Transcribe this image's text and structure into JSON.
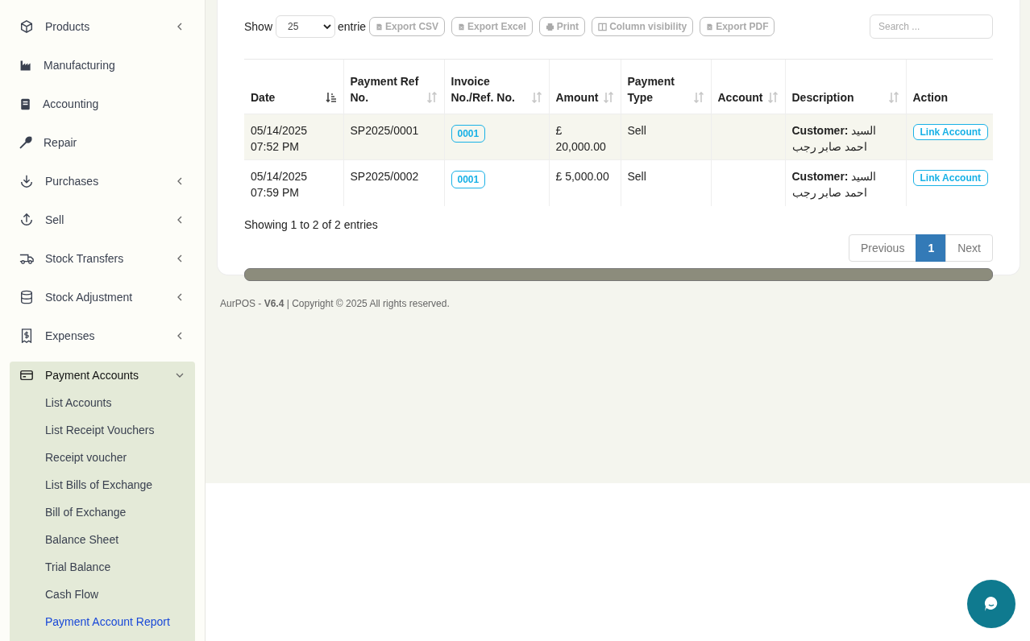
{
  "sidebar": {
    "items": [
      {
        "label": "Products",
        "expandable": true,
        "expanded": false
      },
      {
        "label": "Manufacturing",
        "expandable": false,
        "expanded": false
      },
      {
        "label": "Accounting",
        "expandable": false,
        "expanded": false
      },
      {
        "label": "Repair",
        "expandable": false,
        "expanded": false
      },
      {
        "label": "Purchases",
        "expandable": true,
        "expanded": false
      },
      {
        "label": "Sell",
        "expandable": true,
        "expanded": false
      },
      {
        "label": "Stock Transfers",
        "expandable": true,
        "expanded": false
      },
      {
        "label": "Stock Adjustment",
        "expandable": true,
        "expanded": false
      },
      {
        "label": "Expenses",
        "expandable": true,
        "expanded": false
      },
      {
        "label": "Payment Accounts",
        "expandable": true,
        "expanded": true,
        "children": [
          {
            "label": "List Accounts",
            "selected": false
          },
          {
            "label": "List Receipt Vouchers",
            "selected": false
          },
          {
            "label": "Receipt voucher",
            "selected": false
          },
          {
            "label": "List Bills of Exchange",
            "selected": false
          },
          {
            "label": "Bill of Exchange",
            "selected": false
          },
          {
            "label": "Balance Sheet",
            "selected": false
          },
          {
            "label": "Trial Balance",
            "selected": false
          },
          {
            "label": "Cash Flow",
            "selected": false
          },
          {
            "label": "Payment Account Report",
            "selected": true
          }
        ]
      }
    ]
  },
  "toolbar": {
    "show_label": "Show",
    "page_size": "25",
    "entries_label": "entrie",
    "buttons": [
      {
        "label": "Export CSV",
        "kind": "csv"
      },
      {
        "label": "Export Excel",
        "kind": "excel"
      },
      {
        "label": "Print",
        "kind": "print"
      },
      {
        "label": "Column visibility",
        "kind": "columns"
      },
      {
        "label": "Export PDF",
        "kind": "pdf"
      }
    ],
    "search": {
      "placeholder": "Search ..."
    }
  },
  "table": {
    "columns": [
      {
        "label": "Date",
        "sortable": true,
        "sorted": true
      },
      {
        "label": "Payment Ref No.",
        "sortable": true,
        "sorted": false
      },
      {
        "label": "Invoice No./Ref. No.",
        "sortable": true,
        "sorted": false
      },
      {
        "label": "Amount",
        "sortable": true,
        "sorted": false
      },
      {
        "label": "Payment Type",
        "sortable": true,
        "sorted": false
      },
      {
        "label": "Account",
        "sortable": true,
        "sorted": false
      },
      {
        "label": "Description",
        "sortable": true,
        "sorted": false
      },
      {
        "label": "Action",
        "sortable": false,
        "sorted": false
      }
    ],
    "rows": [
      {
        "date": "05/14/2025 07:52 PM",
        "payment_ref": "SP2025/0001",
        "invoice": "0001",
        "amount": "£ 20,000.00",
        "payment_type": "Sell",
        "description": "**Customer:** السيد احمد صابر رجب",
        "action": "Link Account"
      },
      {
        "date": "05/14/2025 07:59 PM",
        "payment_ref": "SP2025/0002",
        "invoice": "0001",
        "amount": "£ 5,000.00",
        "payment_type": "Sell",
        "description": "**Customer:** السيد احمد صابر رجب",
        "action": "Link Account"
      }
    ]
  },
  "info": "Showing 1 to 2 of 2 entries",
  "pagination": [
    {
      "label": "Previous",
      "selected": false
    },
    {
      "label": "1",
      "selected": true
    },
    {
      "label": "Next",
      "selected": false
    }
  ],
  "footer": "AurPOS - **V6.4** | Copyright © 2025 All rights reserved."
}
